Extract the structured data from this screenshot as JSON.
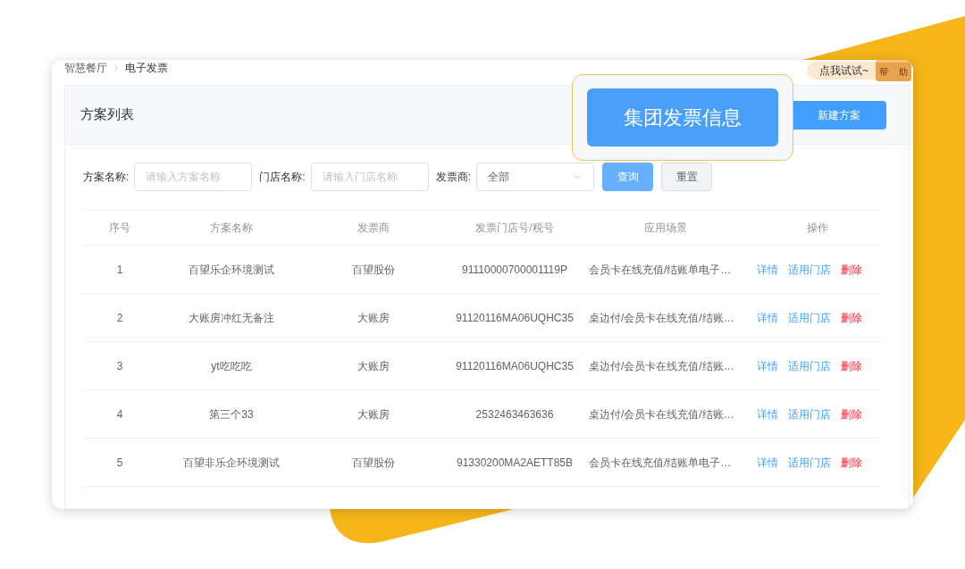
{
  "breadcrumb": [
    {
      "label": "智慧餐厅",
      "current": false
    },
    {
      "label": "电子发票",
      "current": true
    }
  ],
  "help_widget": {
    "hint": "点我试试~",
    "button_chars": [
      "帮",
      "助"
    ]
  },
  "panel": {
    "title": "方案列表",
    "primary_button": "新建方案"
  },
  "callout": {
    "button": "集团发票信息"
  },
  "filters": [
    {
      "kind": "input",
      "label": "方案名称:",
      "placeholder": "请输入方案名称"
    },
    {
      "kind": "input",
      "label": "门店名称:",
      "placeholder": "请输入门店名称"
    },
    {
      "kind": "select",
      "label": "发票商:",
      "value": "全部"
    }
  ],
  "filter_buttons": [
    {
      "kind": "primary",
      "label": "查询"
    },
    {
      "kind": "default",
      "label": "重置"
    }
  ],
  "table": {
    "columns": [
      "序号",
      "方案名称",
      "发票商",
      "发票门店号/税号",
      "应用场景",
      "操作"
    ],
    "rows": [
      {
        "cells": [
          "1",
          "百望乐企环境测试",
          "百望股份",
          "91110000700001119P",
          "会员卡在线充值/结账单电子…"
        ],
        "actions": [
          {
            "kind": "link",
            "label": "详情"
          },
          {
            "kind": "link",
            "label": "适用门店"
          },
          {
            "kind": "danger",
            "label": "删除"
          }
        ]
      },
      {
        "cells": [
          "2",
          "大账房冲红无备注",
          "大账房",
          "91120116MA06UQHC35",
          "桌边付/会员卡在线充值/结账…"
        ],
        "actions": [
          {
            "kind": "link",
            "label": "详情"
          },
          {
            "kind": "link",
            "label": "适用门店"
          },
          {
            "kind": "danger",
            "label": "删除"
          }
        ]
      },
      {
        "cells": [
          "3",
          "yt吃吃吃",
          "大账房",
          "91120116MA06UQHC35",
          "桌边付/会员卡在线充值/结账…"
        ],
        "actions": [
          {
            "kind": "link",
            "label": "详情"
          },
          {
            "kind": "link",
            "label": "适用门店"
          },
          {
            "kind": "danger",
            "label": "删除"
          }
        ]
      },
      {
        "cells": [
          "4",
          "第三个33",
          "大账房",
          "2532463463636",
          "桌边付/会员卡在线充值/结账…"
        ],
        "actions": [
          {
            "kind": "link",
            "label": "详情"
          },
          {
            "kind": "link",
            "label": "适用门店"
          },
          {
            "kind": "danger",
            "label": "删除"
          }
        ]
      },
      {
        "cells": [
          "5",
          "百望非乐企环境测试",
          "百望股份",
          "91330200MA2AETT85B",
          "会员卡在线充值/结账单电子…"
        ],
        "actions": [
          {
            "kind": "link",
            "label": "详情"
          },
          {
            "kind": "link",
            "label": "适用门店"
          },
          {
            "kind": "danger",
            "label": "删除"
          }
        ]
      }
    ]
  }
}
